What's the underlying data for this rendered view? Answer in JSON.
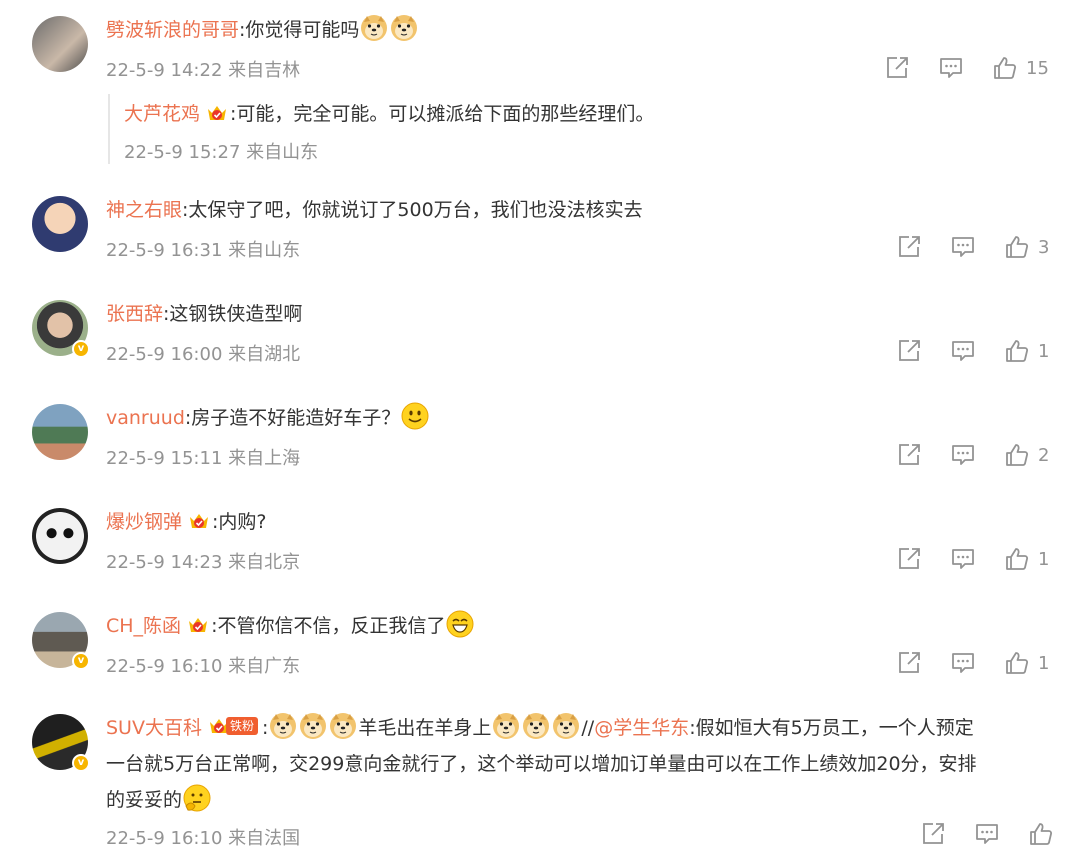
{
  "comments": [
    {
      "username": "劈波斩浪的哥哥",
      "text": ":你觉得可能吗",
      "emojis_after": [
        "doge-emoji",
        "doge-emoji"
      ],
      "meta": "22-5-9 14:22 来自吉林",
      "likes": "15",
      "reply": {
        "username": "大芦花鸡",
        "text": ":可能，完全可能。可以摊派给下面的那些经理们。",
        "meta": "22-5-9 15:27 来自山东"
      }
    },
    {
      "username": "神之右眼",
      "text": ":太保守了吧，你就说订了500万台，我们也没法核实去",
      "meta": "22-5-9 16:31 来自山东",
      "likes": "3"
    },
    {
      "username": "张西辞",
      "text": ":这钢铁侠造型啊",
      "meta": "22-5-9 16:00 来自湖北",
      "likes": "1"
    },
    {
      "username": "vanruud",
      "text": ":房子造不好能造好车子？",
      "meta": "22-5-9 15:11 来自上海",
      "likes": "2"
    },
    {
      "username": "爆炒钢弹",
      "text": ":内购?",
      "meta": "22-5-9 14:23 来自北京",
      "likes": "1"
    },
    {
      "username": "CH_陈函",
      "text": ":不管你信不信，反正我信了",
      "meta": "22-5-9 16:10 来自广东",
      "likes": "1"
    },
    {
      "username": "SUV大百科",
      "fan_badge": "铁粉",
      "text_a": ":",
      "text_b": "羊毛出在羊身上",
      "text_c": "//",
      "mention": "@学生华东",
      "text_d": ":假如恒大有5万员工，一个人预定",
      "text_line2": "一台就5万台正常啊，交299意向金就行了，这个举动可以增加订单量由可以在工作上绩效加20分，安排",
      "text_line3": "的妥妥的",
      "meta": "22-5-9 16:10 来自法国",
      "likes": ""
    }
  ],
  "colors": {
    "username": "#eb7350",
    "meta": "#939393",
    "text": "#333333",
    "badge": "#f7b500"
  },
  "icons": [
    "share-icon",
    "comment-icon",
    "like-icon",
    "doge-emoji",
    "smile-emoji",
    "grin-emoji",
    "thinking-emoji",
    "crown-badge-icon",
    "verified-badge-icon"
  ]
}
